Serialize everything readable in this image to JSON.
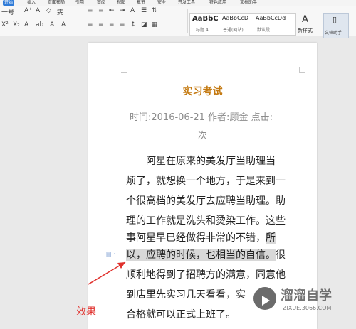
{
  "ribbon": {
    "tabs": [
      "开始",
      "插入",
      "页面布局",
      "引用",
      "审阅",
      "视图",
      "章节",
      "安全",
      "开发工具",
      "特色应用",
      "文档助手"
    ],
    "active_tab": "开始"
  },
  "toolbar": {
    "font_size": "一号",
    "row1": [
      "A⁺",
      "A⁻",
      "◇",
      "雯",
      "≡",
      "≡",
      "⇤",
      "⇥",
      "A",
      "☰",
      "⇅"
    ],
    "row2": [
      "X²",
      "X₂",
      "A",
      "ab",
      "A",
      "A"
    ],
    "styles": [
      {
        "preview": "AaBbC",
        "name": "标题 4"
      },
      {
        "preview": "AaBbCcD",
        "name": "普通(网站)"
      },
      {
        "preview": "AaBbCcDd",
        "name": "默认段..."
      }
    ],
    "new_style": "新样式",
    "doc_helper": "文档助手"
  },
  "document": {
    "title": "实习考试",
    "meta_line1": "时间:2016-06-21  作者:顾金  点击:",
    "meta_line2": "次",
    "lines": [
      "　　阿星在原来的美发厅当助理当",
      "烦了，就想换一个地方，于是来到一",
      "个很高档的美发厅去应聘当助理。助",
      "理的工作就是洗头和烫染工作。这些",
      "事阿星早已经做得非常的不错，所",
      "以，应聘的时候，也相当的自信。很",
      "顺利地得到了招聘方的满意，同意他",
      "到店里先实习几天看看，实",
      "合格就可以正式上班了。"
    ]
  },
  "annotation": {
    "label": "效果",
    "color": "#e0312d"
  },
  "watermark": {
    "cn": "溜溜自学",
    "en": "ZIXUE.3066.COM"
  }
}
